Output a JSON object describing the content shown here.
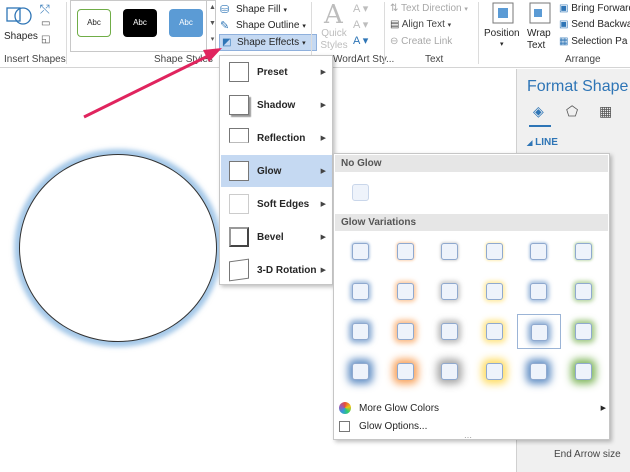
{
  "ribbon": {
    "shapes_label": "Shapes",
    "insert_shapes": "Insert Shapes",
    "style_swatches": [
      "Abc",
      "Abc",
      "Abc"
    ],
    "shape_styles": "Shape Styles",
    "shape_fill": "Shape Fill",
    "shape_outline": "Shape Outline",
    "shape_effects": "Shape Effects",
    "quick_styles": "Quick Styles",
    "wordart_styles": "WordArt Sty...",
    "text_direction": "Text Direction",
    "align_text": "Align Text",
    "create_link": "Create Link",
    "text_group": "Text",
    "position": "Position",
    "wrap_text": "Wrap Text",
    "bring_forward": "Bring Forward",
    "send_backward": "Send Backward",
    "selection_pane": "Selection Pa",
    "arrange": "Arrange"
  },
  "format_pane": {
    "title": "Format Shape",
    "line_section": "LINE",
    "end_arrow_size": "End Arrow size"
  },
  "effects_menu": {
    "items": [
      {
        "label": "Preset"
      },
      {
        "label": "Shadow"
      },
      {
        "label": "Reflection"
      },
      {
        "label": "Glow"
      },
      {
        "label": "Soft Edges"
      },
      {
        "label": "Bevel"
      },
      {
        "label": "3-D Rotation"
      }
    ]
  },
  "glow_gallery": {
    "no_glow": "No Glow",
    "variations": "Glow Variations",
    "more_colors": "More Glow Colors",
    "options": "Glow Options...",
    "colors": [
      "#4f81bd",
      "#f79646",
      "#9b9b9b",
      "#ffd84d",
      "#4f81bd",
      "#70ad47"
    ]
  },
  "colors": {
    "accent": "#2e75b6",
    "arrow": "#e0245e"
  }
}
